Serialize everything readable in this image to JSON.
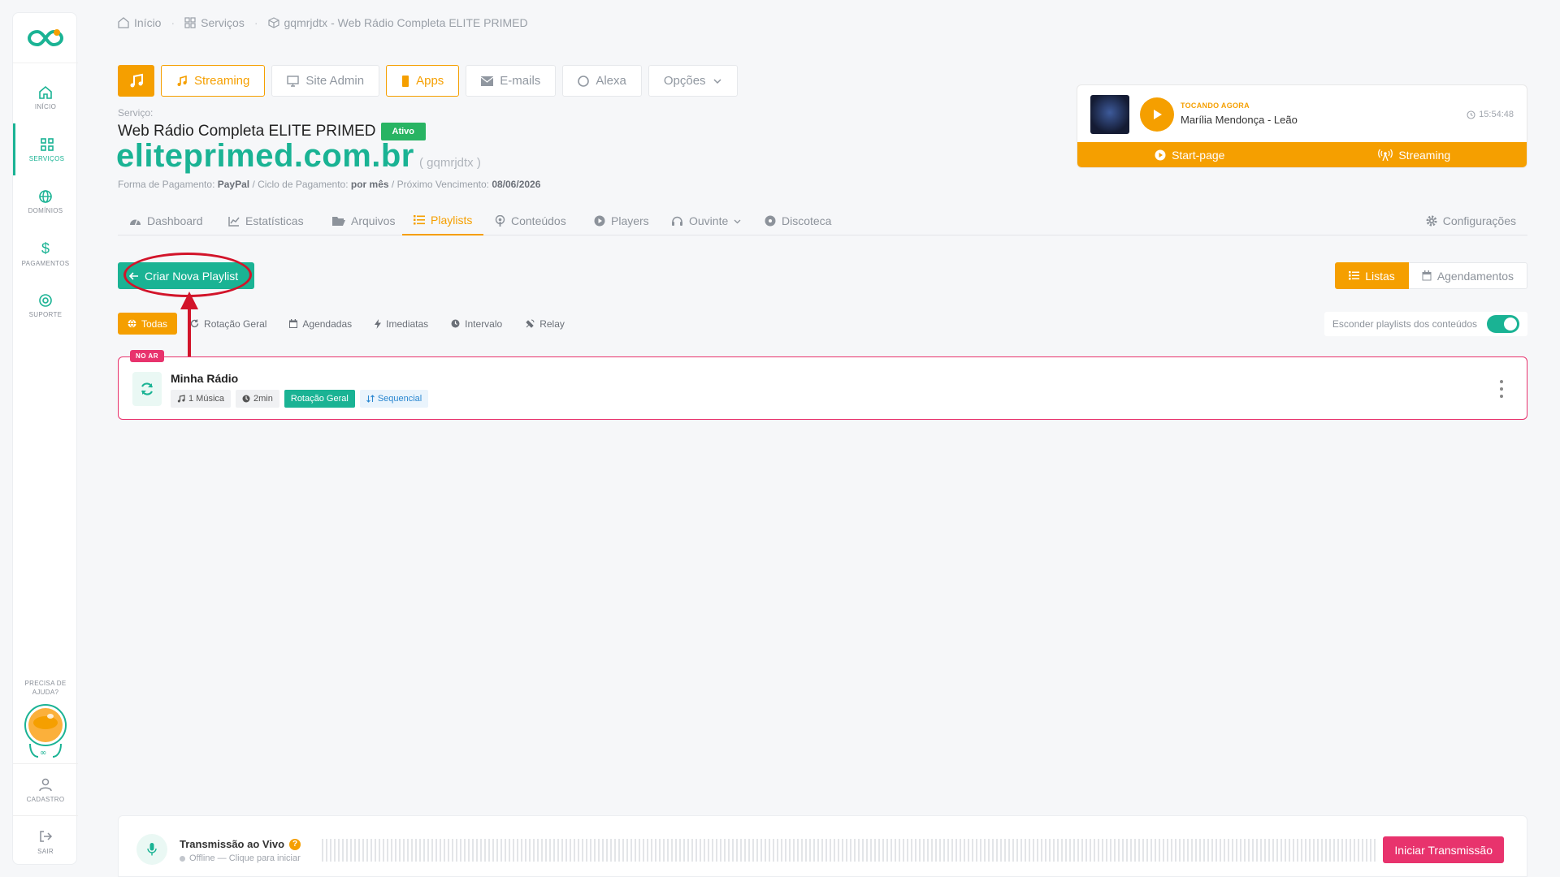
{
  "sidebar": {
    "items": [
      {
        "label": "INÍCIO",
        "icon": "home-icon"
      },
      {
        "label": "SERVIÇOS",
        "icon": "grid-icon"
      },
      {
        "label": "DOMÍNIOS",
        "icon": "globe-icon"
      },
      {
        "label": "PAGAMENTOS",
        "icon": "dollar-icon"
      },
      {
        "label": "SUPORTE",
        "icon": "lifebuoy-icon"
      }
    ],
    "help_text": "PRECISA DE AJUDA?",
    "cadastro_label": "CADASTRO",
    "sair_label": "SAIR",
    "mascot_text": "∞"
  },
  "breadcrumb": [
    "Início",
    "Serviços",
    "gqmrjdtx - Web Rádio Completa ELITE PRIMED"
  ],
  "topbar": {
    "buttons": [
      "Streaming",
      "Site Admin",
      "Apps",
      "E-mails",
      "Alexa",
      "Opções"
    ]
  },
  "service": {
    "label": "Serviço:",
    "name": "Web Rádio Completa ELITE PRIMED",
    "status": "Ativo",
    "domain": "eliteprimed.com.br",
    "code": "( gqmrjdtx )",
    "pay_method_label": "Forma de Pagamento:",
    "pay_method": "PayPal",
    "cycle_label": "/ Ciclo de Pagamento:",
    "cycle": "por mês",
    "due_label": "/ Próximo Vencimento:",
    "due": "08/06/2026"
  },
  "now_playing": {
    "tag": "TOCANDO AGORA",
    "song": "Marília Mendonça - Leão",
    "time": "15:54:48",
    "startpage_label": "Start-page",
    "streaming_label": "Streaming"
  },
  "tabs": [
    "Dashboard",
    "Estatísticas",
    "Arquivos",
    "Playlists",
    "Conteúdos",
    "Players",
    "Ouvinte",
    "Discoteca",
    "Configurações"
  ],
  "actions": {
    "create_label": "Criar Nova Playlist",
    "view_lists": "Listas",
    "view_schedules": "Agendamentos"
  },
  "filters": [
    "Todas",
    "Rotação Geral",
    "Agendadas",
    "Imediatas",
    "Intervalo",
    "Relay"
  ],
  "hide_toggle_label": "Esconder playlists dos conteúdos",
  "playlist": {
    "badge": "NO AR",
    "title": "Minha Rádio",
    "tags": [
      "1 Música",
      "2min",
      "Rotação Geral",
      "Sequencial"
    ]
  },
  "live": {
    "title": "Transmissão ao Vivo",
    "help": "?",
    "status": "Offline — Clique para iniciar",
    "button": "Iniciar Transmissão"
  },
  "colors": {
    "primary": "#1ab394",
    "accent": "#f59f00",
    "danger": "#e8336d",
    "annotation": "#d2142a"
  }
}
